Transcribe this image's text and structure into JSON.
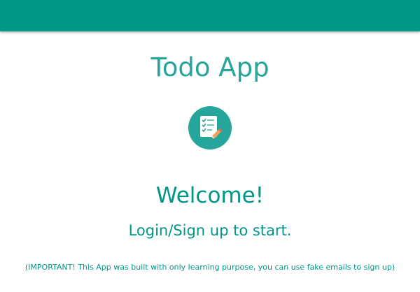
{
  "header": {
    "color": "#009688"
  },
  "app": {
    "title": "Todo App",
    "logo_icon": "checklist-pencil-icon"
  },
  "welcome": {
    "heading": "Welcome!",
    "subtitle": "Login/Sign up to start.",
    "notice": "(IMPORTANT! This App was built with only learning purpose, you can use fake emails to sign up)"
  },
  "colors": {
    "primary": "#009688",
    "accent": "#26a69a",
    "background": "#ffffff"
  }
}
